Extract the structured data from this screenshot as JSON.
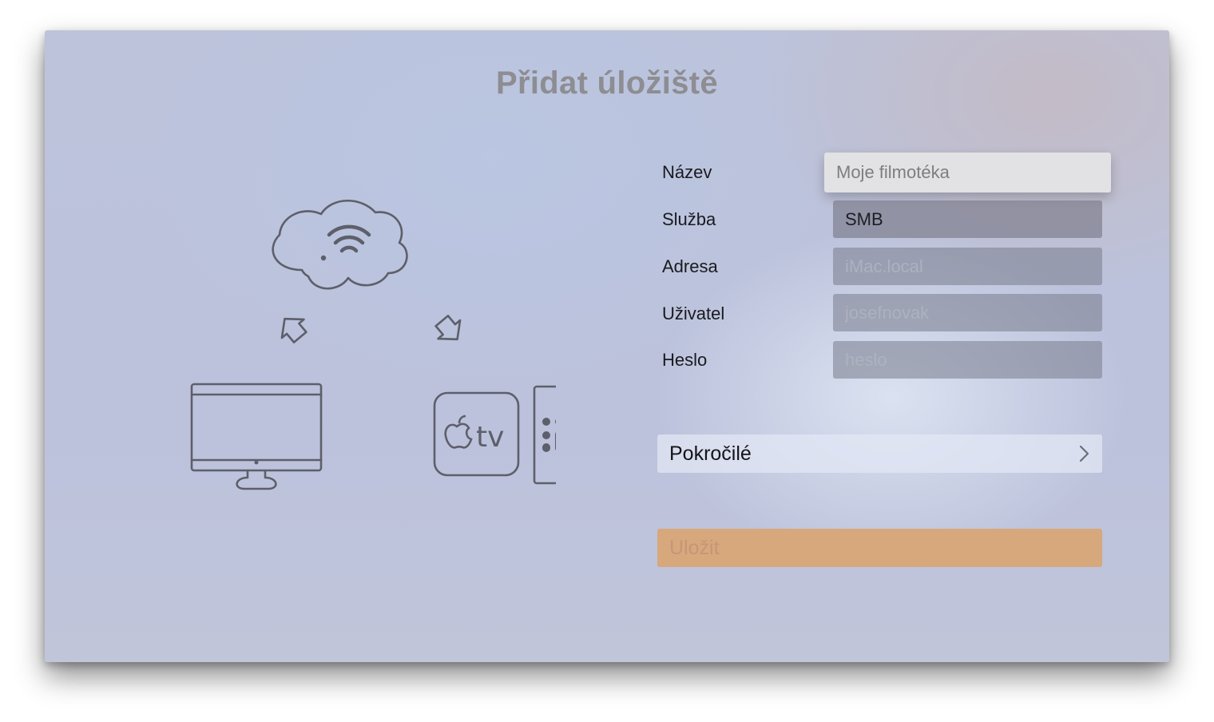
{
  "page": {
    "title": "Přidat úložiště"
  },
  "illustration": {
    "tv_label": "tv"
  },
  "form": {
    "fields": [
      {
        "label": "Název",
        "value": "Moje filmotéka",
        "kind": "placeholder",
        "focused": true
      },
      {
        "label": "Služba",
        "value": "SMB",
        "kind": "value",
        "focused": false
      },
      {
        "label": "Adresa",
        "value": "iMac.local",
        "kind": "placeholder",
        "focused": false
      },
      {
        "label": "Uživatel",
        "value": "josefnovak",
        "kind": "placeholder",
        "focused": false
      },
      {
        "label": "Heslo",
        "value": "heslo",
        "kind": "placeholder",
        "focused": false
      }
    ],
    "advanced_label": "Pokročilé",
    "save_label": "Uložit"
  },
  "colors": {
    "save_button": "#d7a87c",
    "focused_field": "#e2e2e4",
    "icon_stroke": "#5d5f6a"
  },
  "icons": {
    "cloud": "cloud-wifi-icon",
    "arrow_left": "arrow-up-left-icon",
    "arrow_right": "arrow-down-right-icon",
    "computer": "imac-icon",
    "apple_tv": "apple-tv-icon",
    "remote": "remote-icon",
    "advanced_chevron": "chevron-right-icon"
  }
}
